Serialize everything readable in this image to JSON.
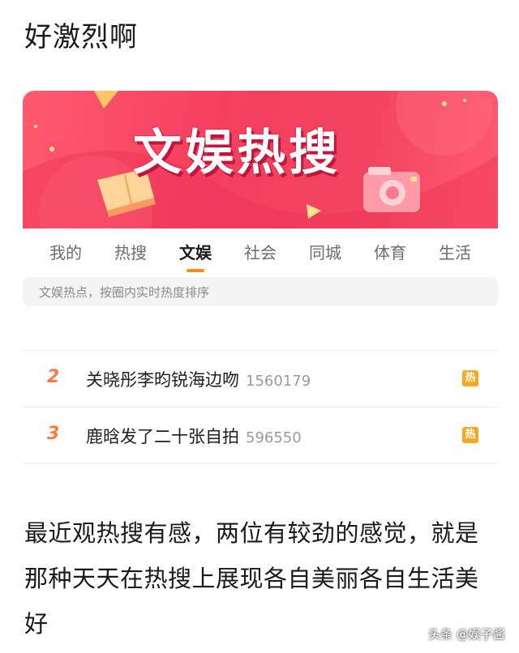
{
  "post": {
    "title": "好激烈啊"
  },
  "banner": {
    "title": "文娱热搜"
  },
  "tabs": [
    {
      "label": "我的"
    },
    {
      "label": "热搜"
    },
    {
      "label": "文娱",
      "active": true
    },
    {
      "label": "社会"
    },
    {
      "label": "同城"
    },
    {
      "label": "体育"
    },
    {
      "label": "生活"
    }
  ],
  "subtitle": "文娱热点，按圈内实时热度排序",
  "hot_list": [
    {
      "rank": "2",
      "topic": "关晓彤李昀锐海边吻",
      "count": "1560179",
      "badge": "热"
    },
    {
      "rank": "3",
      "topic": "鹿晗发了二十张自拍",
      "count": "596550",
      "badge": "热"
    }
  ],
  "comment": "最近观热搜有感，两位有较劲的感觉，就是那种天天在热搜上展现各自美丽各自生活美好",
  "watermark": "头条 @娱子酱",
  "colors": {
    "banner": "#f53f5f",
    "active_tab_underline": "#ff8a1f",
    "rank": "#ff7a3d",
    "hot_badge": "#f7a823"
  }
}
